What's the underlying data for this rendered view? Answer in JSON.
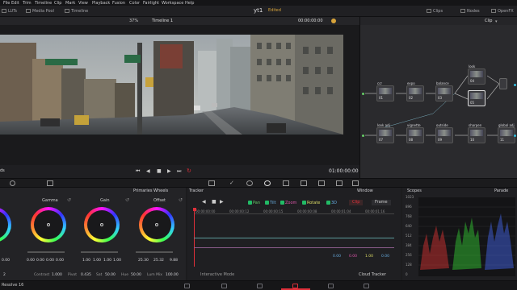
{
  "menu": [
    "File",
    "Edit",
    "Trim",
    "Timeline",
    "Clip",
    "Mark",
    "View",
    "Playback",
    "Fusion",
    "Color",
    "Fairlight",
    "Workspace",
    "Help"
  ],
  "toolbar": {
    "luts": "LUTs",
    "media_pool": "Media Pool",
    "timeline": "Timeline",
    "project_title": "yt1",
    "edited": "Edited",
    "clips": "Clips",
    "nodes": "Nodes",
    "openfx": "OpenFX"
  },
  "viewer": {
    "zoom": "37%",
    "timeline_name": "Timeline 1",
    "timecode_top": "00:00:00:00",
    "selected_still": "Selected Still Images",
    "timecode": "01:00:00:00",
    "left_label": "ds"
  },
  "node_editor": {
    "clip": "Clip",
    "nodes": [
      {
        "label": "ccr",
        "num": "01"
      },
      {
        "label": "expo",
        "num": "02"
      },
      {
        "label": "balance",
        "num": "03"
      },
      {
        "label": "look",
        "num": "04"
      },
      {
        "label": "",
        "num": "05"
      },
      {
        "label": "look adj",
        "num": "07"
      },
      {
        "label": "vignette",
        "num": "08"
      },
      {
        "label": "outside",
        "num": "09"
      },
      {
        "label": "sharpen",
        "num": "10"
      },
      {
        "label": "global adj",
        "num": "11"
      }
    ]
  },
  "wheels": {
    "panel_title": "Primaries Wheels",
    "gamma": "Gamma",
    "gain": "Gain",
    "offset": "Offset",
    "lift_vals": [
      "0.00"
    ],
    "gamma_vals": [
      "0.00",
      "0.00",
      "0.00",
      "0.00"
    ],
    "gain_vals": [
      "1.00",
      "1.00",
      "1.00",
      "1.00"
    ],
    "offset_vals": [
      "25.30",
      "25.32",
      "9.88"
    ],
    "footer": {
      "page": "2",
      "contrast_label": "Contrast",
      "contrast": "1.000",
      "pivot_label": "Pivot",
      "pivot": "0.435",
      "sat_label": "Sat",
      "sat": "50.00",
      "hue_label": "Hue",
      "hue": "50.00",
      "lummix_label": "Lum Mix",
      "lummix": "100.00"
    }
  },
  "tracker": {
    "title": "Tracker",
    "window": "Window",
    "pan": "Pan",
    "tilt": "Tilt",
    "zoom": "Zoom",
    "rotate": "Rotate",
    "three_d": "3D",
    "clip": "Clip",
    "frame": "Frame",
    "ticks": [
      "00:00:00:00",
      "00:00:00:12",
      "00:00:00:15",
      "00:00:00:08",
      "00:00:01:04",
      "00:00:01:16"
    ],
    "values": [
      "0.00",
      "0.00",
      "1.00",
      "0.00"
    ],
    "interactive_mode": "Interactive Mode",
    "cloud_tracker": "Cloud Tracker"
  },
  "scopes": {
    "title": "Scopes",
    "mode": "Parade",
    "scale": [
      "1023",
      "896",
      "768",
      "640",
      "512",
      "384",
      "256",
      "128",
      "0"
    ]
  },
  "footer": {
    "app": "Resolve 16"
  },
  "colors": {
    "accent_red": "#e0303a",
    "edited": "#d7a33a",
    "check_green": "#22bb66"
  }
}
